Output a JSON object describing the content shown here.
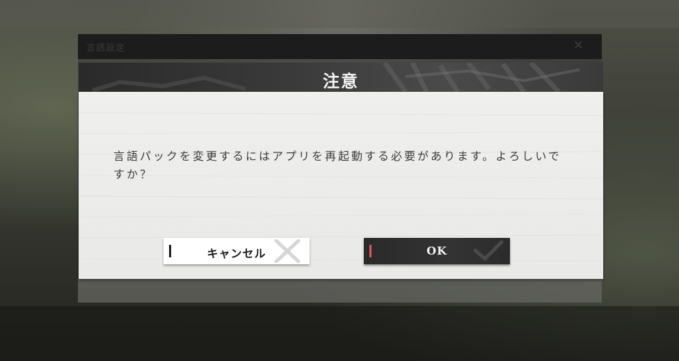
{
  "background_window": {
    "title": "言語設定",
    "close_glyph": "✕"
  },
  "dialog": {
    "title": "注意",
    "message": "言語パックを変更するにはアプリを再起動する必要があります。よろしいですか？"
  },
  "buttons": {
    "cancel_label": "キャンセル",
    "ok_label": "OK"
  },
  "colors": {
    "header_dark": "#2a2a2a",
    "body_light": "#efefed",
    "ok_accent": "#e05858",
    "cancel_accent": "#1e1e1e"
  },
  "icons": {
    "cancel": "x-icon",
    "ok": "checkmark-icon"
  }
}
